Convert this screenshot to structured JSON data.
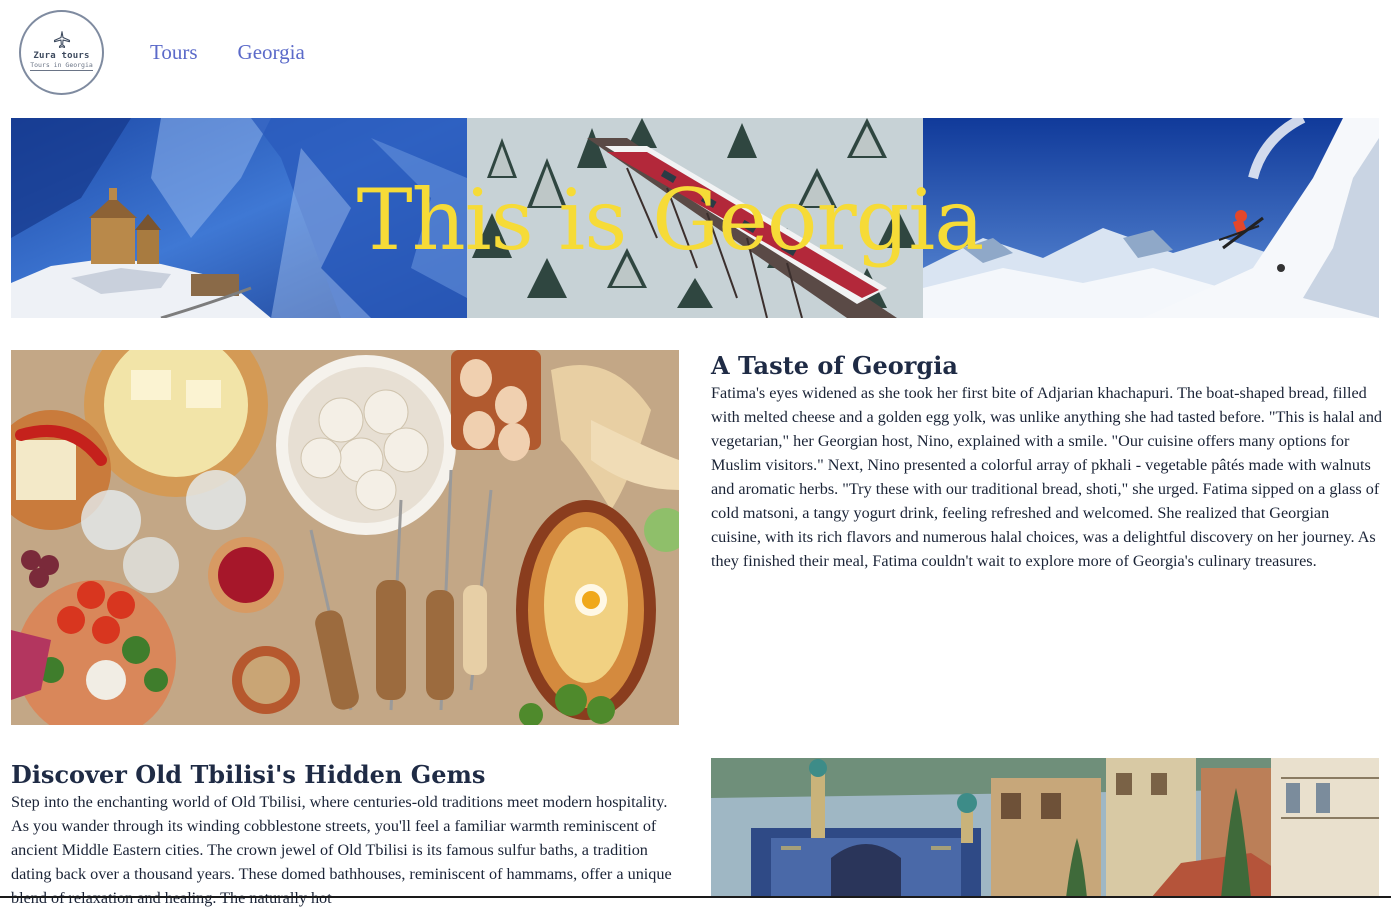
{
  "header": {
    "logo": {
      "icon": "airplane-icon",
      "title": "Zura tours",
      "subtitle": "Tours in Georgia"
    },
    "nav": [
      {
        "label": "Tours"
      },
      {
        "label": "Georgia"
      }
    ]
  },
  "hero": {
    "title": "This is Georgia",
    "title_color": "#f6db37",
    "panels": [
      "gergeti-trinity-church-image",
      "snowy-forest-train-bridge-image",
      "mountain-skier-image"
    ]
  },
  "sections": {
    "taste": {
      "heading": "A Taste of Georgia",
      "body": "Fatima's eyes widened as she took her first bite of Adjarian khachapuri. The boat-shaped bread, filled with melted cheese and a golden egg yolk, was unlike anything she had tasted before. \"This is halal and vegetarian,\" her Georgian host, Nino, explained with a smile. \"Our cuisine offers many options for Muslim visitors.\" Next, Nino presented a colorful array of pkhali - vegetable pâtés made with walnuts and aromatic herbs. \"Try these with our traditional bread, shoti,\" she urged. Fatima sipped on a glass of cold matsoni, a tangy yogurt drink, feeling refreshed and welcomed. She realized that Georgian cuisine, with its rich flavors and numerous halal choices, was a delightful discovery on her journey. As they finished their meal, Fatima couldn't wait to explore more of Georgia's culinary treasures.",
      "image": "georgian-food-table-image"
    },
    "tbilisi": {
      "heading": "Discover Old Tbilisi's Hidden Gems",
      "body": "Step into the enchanting world of Old Tbilisi, where centuries-old traditions meet modern hospitality. As you wander through its winding cobblestone streets, you'll feel a familiar warmth reminiscent of ancient Middle Eastern cities. The crown jewel of Old Tbilisi is its famous sulfur baths, a tradition dating back over a thousand years. These domed bathhouses, reminiscent of hammams, offer a unique blend of relaxation and healing. The naturally hot",
      "image": "old-tbilisi-bathhouse-image"
    }
  }
}
